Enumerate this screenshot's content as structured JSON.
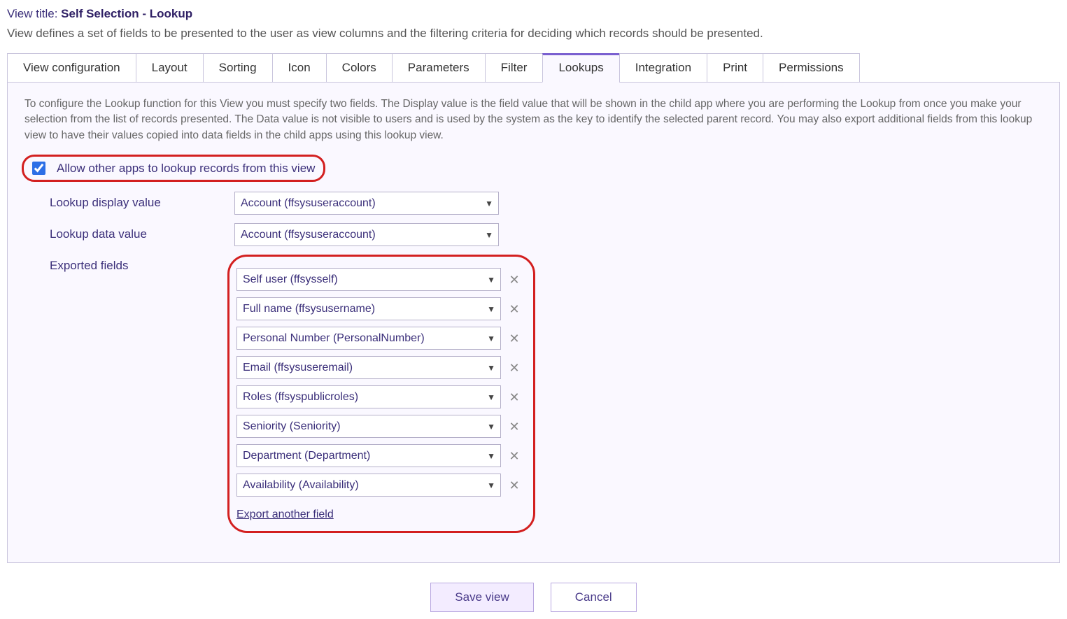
{
  "header": {
    "title_prefix": "View title: ",
    "title_value": "Self Selection - Lookup",
    "description": "View defines a set of fields to be presented to the user as view columns and the filtering criteria for deciding which records should be presented."
  },
  "tabs": [
    "View configuration",
    "Layout",
    "Sorting",
    "Icon",
    "Colors",
    "Parameters",
    "Filter",
    "Lookups",
    "Integration",
    "Print",
    "Permissions"
  ],
  "active_tab_index": 7,
  "panel": {
    "help_text": "To configure the Lookup function for this View you must specify two fields. The Display value is the field value that will be shown in the child app where you are performing the Lookup from once you make your selection from the list of records presented. The Data value is not visible to users and is used by the system as the key to identify the selected parent record. You may also export additional fields from this lookup view to have their values copied into data fields in the child apps using this lookup view.",
    "allow_lookup_checked": true,
    "allow_lookup_label": "Allow other apps to lookup records from this view",
    "labels": {
      "display_value": "Lookup display value",
      "data_value": "Lookup data value",
      "exported_fields": "Exported fields"
    },
    "display_value": "Account (ffsysuseraccount)",
    "data_value": "Account (ffsysuseraccount)",
    "exported_fields": [
      "Self user (ffsysself)",
      "Full name (ffsysusername)",
      "Personal Number (PersonalNumber)",
      "Email (ffsysuseremail)",
      "Roles (ffsyspublicroles)",
      "Seniority (Seniority)",
      "Department (Department)",
      "Availability (Availability)"
    ],
    "export_another_label": "Export another field"
  },
  "buttons": {
    "save": "Save view",
    "cancel": "Cancel"
  }
}
